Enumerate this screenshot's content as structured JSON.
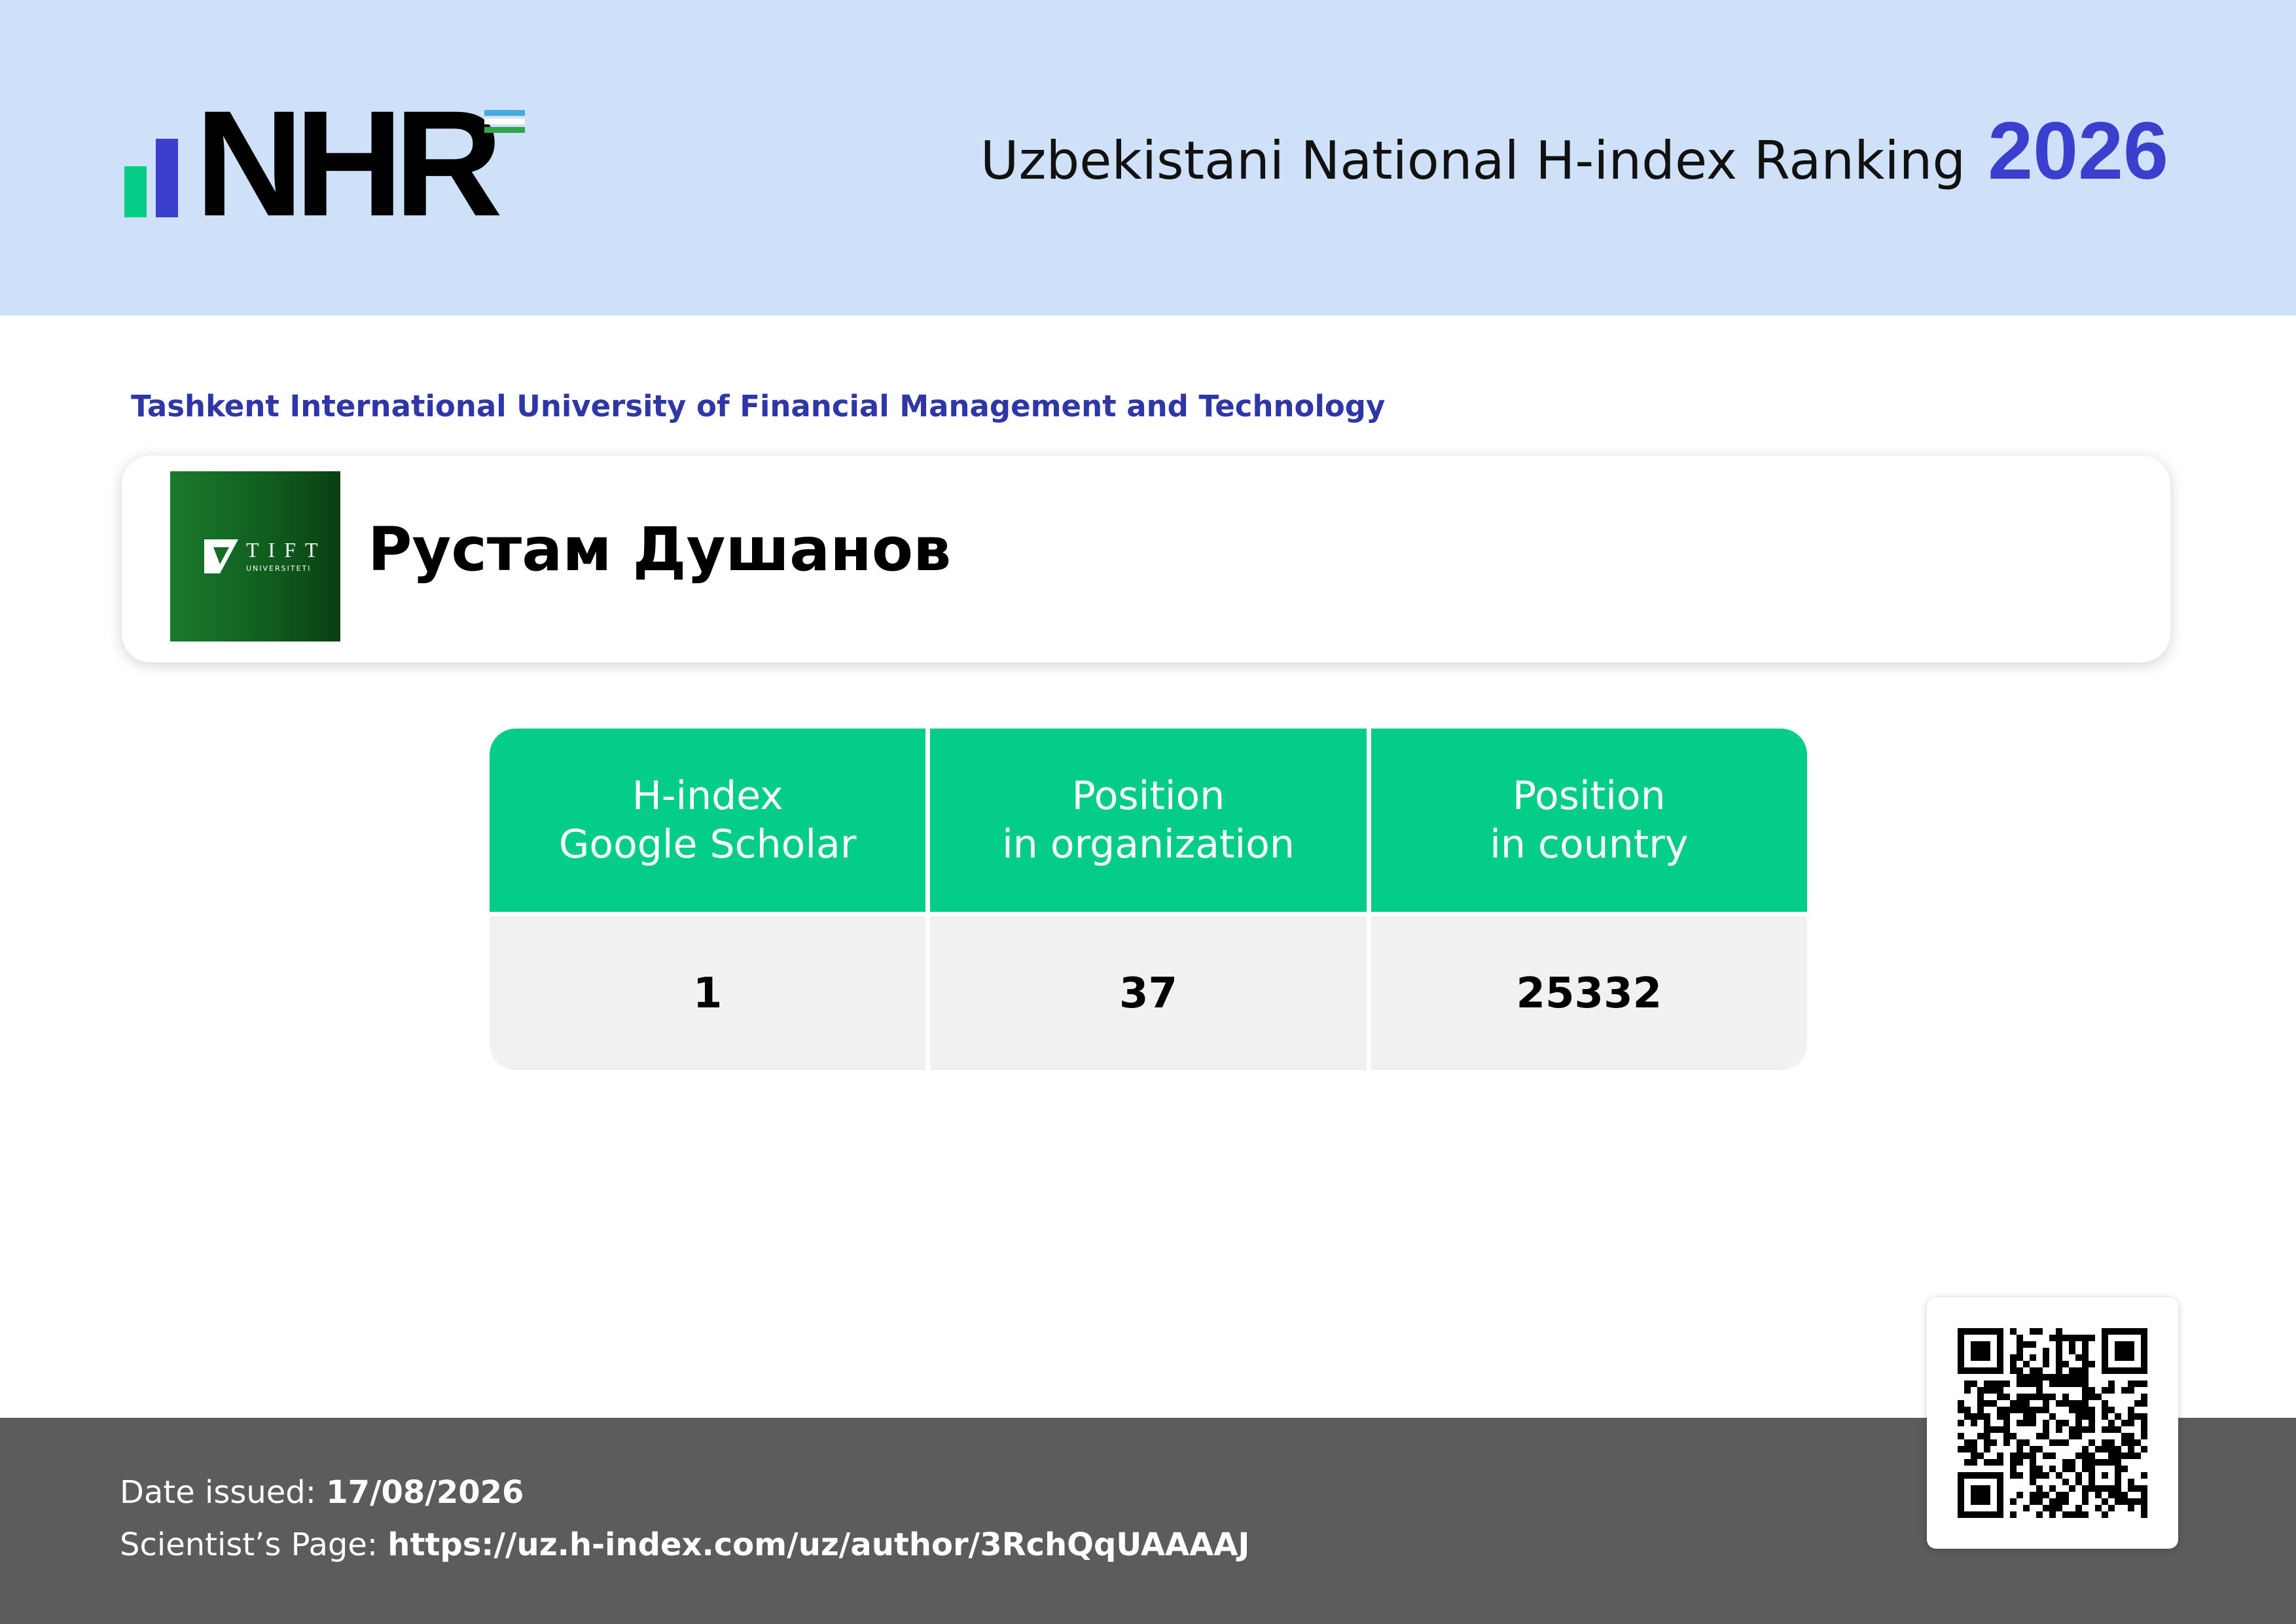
{
  "header": {
    "logo_text": "NHR",
    "title": "Uzbekistani National H-index Ranking",
    "year": "2026"
  },
  "organization": {
    "name": "Tashkent International University of Financial Management and Technology",
    "logo_text": "TIFT",
    "logo_subtext": "UNIVERSITETI"
  },
  "scientist": {
    "name": "Рустам Душанов"
  },
  "stats": [
    {
      "label_line1": "H-index",
      "label_line2": "Google Scholar",
      "value": "1"
    },
    {
      "label_line1": "Position",
      "label_line2": "in organization",
      "value": "37"
    },
    {
      "label_line1": "Position",
      "label_line2": "in country",
      "value": "25332"
    }
  ],
  "footer": {
    "date_label": "Date issued:",
    "date_value": "17/08/2026",
    "page_label": "Scientist’s Page:",
    "page_value": "https://uz.h-index.com/uz/author/3RchQqUAAAAJ"
  },
  "colors": {
    "header_bg": "#cfe1f8",
    "accent_blue": "#3b3fce",
    "accent_green": "#04cd88",
    "footer_bg": "#5c5c5c"
  },
  "icons": {
    "logo": "nhr-bars-icon",
    "flag": "uzbekistan-flag-icon",
    "qr": "qr-code-icon"
  }
}
